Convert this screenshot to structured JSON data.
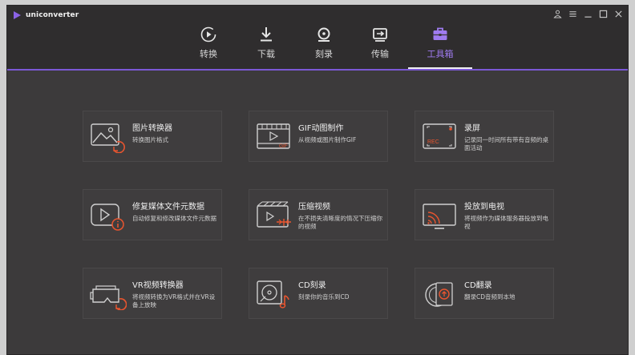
{
  "app": {
    "title": "uniconverter",
    "accent_color": "#7c58d6",
    "active_tab_color": "#9f7bf0"
  },
  "window_controls": {
    "icons": [
      "account-icon",
      "menu-icon",
      "minimize-icon",
      "maximize-icon",
      "close-icon"
    ]
  },
  "nav": {
    "tabs": [
      {
        "label": "转换",
        "icon": "convert-icon",
        "active": false
      },
      {
        "label": "下载",
        "icon": "download-icon",
        "active": false
      },
      {
        "label": "刻录",
        "icon": "burn-icon",
        "active": false
      },
      {
        "label": "传输",
        "icon": "transfer-icon",
        "active": false
      },
      {
        "label": "工具箱",
        "icon": "toolbox-icon",
        "active": true
      }
    ]
  },
  "tools": [
    {
      "title": "图片转换器",
      "desc": "转换图片格式",
      "icon": "image-converter-icon"
    },
    {
      "title": "GIF动图制作",
      "desc": "从视频或图片制作GIF",
      "icon": "gif-maker-icon"
    },
    {
      "title": "录屏",
      "desc": "记录同一时间所有带有音频的桌面活动",
      "icon": "screen-recorder-icon",
      "icon_text": "REC"
    },
    {
      "title": "修复媒体文件元数据",
      "desc": "自动修复和修改媒体文件元数据",
      "icon": "metadata-fix-icon"
    },
    {
      "title": "压缩视频",
      "desc": "在不损失清晰度的情况下压缩你的视频",
      "icon": "compress-video-icon"
    },
    {
      "title": "投放到电视",
      "desc": "将视频作为媒体服务器投放到电视",
      "icon": "cast-to-tv-icon"
    },
    {
      "title": "VR视频转换器",
      "desc": "将视频转换为VR格式并在VR设备上放映",
      "icon": "vr-converter-icon"
    },
    {
      "title": "CD刻录",
      "desc": "刻录你的音乐到CD",
      "icon": "cd-burner-icon"
    },
    {
      "title": "CD翻录",
      "desc": "翻录CD音频到本地",
      "icon": "cd-ripper-icon"
    }
  ]
}
